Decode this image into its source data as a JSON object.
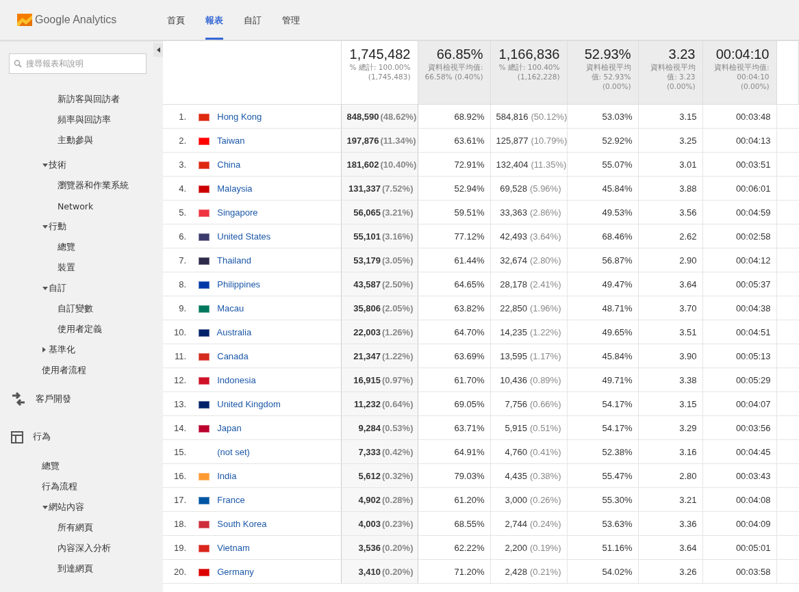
{
  "header": {
    "logo_text": "Google Analytics",
    "tabs": [
      {
        "label": "首頁",
        "selected": false
      },
      {
        "label": "報表",
        "selected": true
      },
      {
        "label": "自訂",
        "selected": false
      },
      {
        "label": "管理",
        "selected": false
      }
    ]
  },
  "sidebar": {
    "search": {
      "placeholder": "搜尋報表和說明"
    },
    "continued_items": [
      {
        "label": "新訪客與回訪者"
      },
      {
        "label": "頻率與回訪率"
      },
      {
        "label": "主動參與"
      }
    ],
    "items": [
      {
        "label": "技術",
        "expanded": true,
        "children": [
          {
            "label": "瀏覽器和作業系統"
          },
          {
            "label": "Network"
          }
        ]
      },
      {
        "label": "行動",
        "expanded": true,
        "children": [
          {
            "label": "總覽"
          },
          {
            "label": "裝置"
          }
        ]
      },
      {
        "label": "自訂",
        "expanded": true,
        "children": [
          {
            "label": "自訂變數"
          },
          {
            "label": "使用者定義"
          }
        ]
      },
      {
        "label": "基準化",
        "expanded": false
      },
      {
        "label": "使用者流程"
      }
    ],
    "sections": [
      {
        "label": "客戶開發",
        "kind": "acquisition"
      },
      {
        "label": "行為",
        "kind": "behavior",
        "children": [
          {
            "label": "總覽"
          },
          {
            "label": "行為流程"
          },
          {
            "label": "網站內容",
            "expanded": true,
            "children": [
              {
                "label": "所有網頁"
              },
              {
                "label": "內容深入分析"
              },
              {
                "label": "到達網頁"
              }
            ]
          }
        ]
      }
    ]
  },
  "table": {
    "columns": [
      {
        "value": "1,745,482",
        "sub_lines": [
          "% 總計: 100.00%",
          "(1,745,483)"
        ],
        "sorted": true
      },
      {
        "value": "66.85%",
        "sub_lines": [
          "資料檢視平均值:",
          "66.58% (0.40%)"
        ],
        "sorted": false
      },
      {
        "value": "1,166,836",
        "sub_lines": [
          "% 總計: 100.40%",
          "(1,162,228)"
        ],
        "sorted": false
      },
      {
        "value": "52.93%",
        "sub_lines": [
          "資料檢視平均",
          "值: 52.93%",
          "(0.00%)"
        ],
        "sorted": false
      },
      {
        "value": "3.23",
        "sub_lines": [
          "資料檢視平均",
          "值: 3.23",
          "(0.00%)"
        ],
        "sorted": false
      },
      {
        "value": "00:04:10",
        "sub_lines": [
          "資料檢視平均值:",
          "00:04:10",
          "(0.00%)"
        ],
        "sorted": false
      }
    ],
    "rows": [
      {
        "rank": "1.",
        "country": "Hong Kong",
        "color": "#de2910",
        "cells": [
          {
            "value": "848,590",
            "share": "(48.62%)"
          },
          {
            "value": "68.92%"
          },
          {
            "value": "584,816",
            "share": "(50.12%)"
          },
          {
            "value": "53.03%"
          },
          {
            "value": "3.15"
          },
          {
            "value": "00:03:48"
          }
        ]
      },
      {
        "rank": "2.",
        "country": "Taiwan",
        "color": "#fe0000",
        "cells": [
          {
            "value": "197,876",
            "share": "(11.34%)"
          },
          {
            "value": "63.61%"
          },
          {
            "value": "125,877",
            "share": "(10.79%)"
          },
          {
            "value": "52.92%"
          },
          {
            "value": "3.25"
          },
          {
            "value": "00:04:13"
          }
        ]
      },
      {
        "rank": "3.",
        "country": "China",
        "color": "#de2910",
        "cells": [
          {
            "value": "181,602",
            "share": "(10.40%)"
          },
          {
            "value": "72.91%"
          },
          {
            "value": "132,404",
            "share": "(11.35%)"
          },
          {
            "value": "55.07%"
          },
          {
            "value": "3.01"
          },
          {
            "value": "00:03:51"
          }
        ]
      },
      {
        "rank": "4.",
        "country": "Malaysia",
        "color": "#cc0001",
        "cells": [
          {
            "value": "131,337",
            "share": "(7.52%)"
          },
          {
            "value": "52.94%"
          },
          {
            "value": "69,528",
            "share": "(5.96%)"
          },
          {
            "value": "45.84%"
          },
          {
            "value": "3.88"
          },
          {
            "value": "00:06:01"
          }
        ]
      },
      {
        "rank": "5.",
        "country": "Singapore",
        "color": "#ef3340",
        "cells": [
          {
            "value": "56,065",
            "share": "(3.21%)"
          },
          {
            "value": "59.51%"
          },
          {
            "value": "33,363",
            "share": "(2.86%)"
          },
          {
            "value": "49.53%"
          },
          {
            "value": "3.56"
          },
          {
            "value": "00:04:59"
          }
        ]
      },
      {
        "rank": "6.",
        "country": "United States",
        "color": "#3c3b6e",
        "cells": [
          {
            "value": "55,101",
            "share": "(3.16%)"
          },
          {
            "value": "77.12%"
          },
          {
            "value": "42,493",
            "share": "(3.64%)"
          },
          {
            "value": "68.46%"
          },
          {
            "value": "2.62"
          },
          {
            "value": "00:02:58"
          }
        ]
      },
      {
        "rank": "7.",
        "country": "Thailand",
        "color": "#2d2a4a",
        "cells": [
          {
            "value": "53,179",
            "share": "(3.05%)"
          },
          {
            "value": "61.44%"
          },
          {
            "value": "32,674",
            "share": "(2.80%)"
          },
          {
            "value": "56.87%"
          },
          {
            "value": "2.90"
          },
          {
            "value": "00:04:12"
          }
        ]
      },
      {
        "rank": "8.",
        "country": "Philippines",
        "color": "#0038a8",
        "cells": [
          {
            "value": "43,587",
            "share": "(2.50%)"
          },
          {
            "value": "64.65%"
          },
          {
            "value": "28,178",
            "share": "(2.41%)"
          },
          {
            "value": "49.47%"
          },
          {
            "value": "3.64"
          },
          {
            "value": "00:05:37"
          }
        ]
      },
      {
        "rank": "9.",
        "country": "Macau",
        "color": "#00785e",
        "cells": [
          {
            "value": "35,806",
            "share": "(2.05%)"
          },
          {
            "value": "63.82%"
          },
          {
            "value": "22,850",
            "share": "(1.96%)"
          },
          {
            "value": "48.71%"
          },
          {
            "value": "3.70"
          },
          {
            "value": "00:04:38"
          }
        ]
      },
      {
        "rank": "10.",
        "country": "Australia",
        "color": "#012169",
        "cells": [
          {
            "value": "22,003",
            "share": "(1.26%)"
          },
          {
            "value": "64.70%"
          },
          {
            "value": "14,235",
            "share": "(1.22%)"
          },
          {
            "value": "49.65%"
          },
          {
            "value": "3.51"
          },
          {
            "value": "00:04:51"
          }
        ]
      },
      {
        "rank": "11.",
        "country": "Canada",
        "color": "#d52b1e",
        "cells": [
          {
            "value": "21,347",
            "share": "(1.22%)"
          },
          {
            "value": "63.69%"
          },
          {
            "value": "13,595",
            "share": "(1.17%)"
          },
          {
            "value": "45.84%"
          },
          {
            "value": "3.90"
          },
          {
            "value": "00:05:13"
          }
        ]
      },
      {
        "rank": "12.",
        "country": "Indonesia",
        "color": "#ce1126",
        "cells": [
          {
            "value": "16,915",
            "share": "(0.97%)"
          },
          {
            "value": "61.70%"
          },
          {
            "value": "10,436",
            "share": "(0.89%)"
          },
          {
            "value": "49.71%"
          },
          {
            "value": "3.38"
          },
          {
            "value": "00:05:29"
          }
        ]
      },
      {
        "rank": "13.",
        "country": "United Kingdom",
        "color": "#012169",
        "cells": [
          {
            "value": "11,232",
            "share": "(0.64%)"
          },
          {
            "value": "69.05%"
          },
          {
            "value": "7,756",
            "share": "(0.66%)"
          },
          {
            "value": "54.17%"
          },
          {
            "value": "3.15"
          },
          {
            "value": "00:04:07"
          }
        ]
      },
      {
        "rank": "14.",
        "country": "Japan",
        "color": "#bc002d",
        "cells": [
          {
            "value": "9,284",
            "share": "(0.53%)"
          },
          {
            "value": "63.71%"
          },
          {
            "value": "5,915",
            "share": "(0.51%)"
          },
          {
            "value": "54.17%"
          },
          {
            "value": "3.29"
          },
          {
            "value": "00:03:56"
          }
        ]
      },
      {
        "rank": "15.",
        "country": "(not set)",
        "cells": [
          {
            "value": "7,333",
            "share": "(0.42%)"
          },
          {
            "value": "64.91%"
          },
          {
            "value": "4,760",
            "share": "(0.41%)"
          },
          {
            "value": "52.38%"
          },
          {
            "value": "3.16"
          },
          {
            "value": "00:04:45"
          }
        ]
      },
      {
        "rank": "16.",
        "country": "India",
        "color": "#ff9933",
        "cells": [
          {
            "value": "5,612",
            "share": "(0.32%)"
          },
          {
            "value": "79.03%"
          },
          {
            "value": "4,435",
            "share": "(0.38%)"
          },
          {
            "value": "55.47%"
          },
          {
            "value": "2.80"
          },
          {
            "value": "00:03:43"
          }
        ]
      },
      {
        "rank": "17.",
        "country": "France",
        "color": "#0055a4",
        "cells": [
          {
            "value": "4,902",
            "share": "(0.28%)"
          },
          {
            "value": "61.20%"
          },
          {
            "value": "3,000",
            "share": "(0.26%)"
          },
          {
            "value": "55.30%"
          },
          {
            "value": "3.21"
          },
          {
            "value": "00:04:08"
          }
        ]
      },
      {
        "rank": "18.",
        "country": "South Korea",
        "color": "#cd2e3a",
        "cells": [
          {
            "value": "4,003",
            "share": "(0.23%)"
          },
          {
            "value": "68.55%"
          },
          {
            "value": "2,744",
            "share": "(0.24%)"
          },
          {
            "value": "53.63%"
          },
          {
            "value": "3.36"
          },
          {
            "value": "00:04:09"
          }
        ]
      },
      {
        "rank": "19.",
        "country": "Vietnam",
        "color": "#da251d",
        "cells": [
          {
            "value": "3,536",
            "share": "(0.20%)"
          },
          {
            "value": "62.22%"
          },
          {
            "value": "2,200",
            "share": "(0.19%)"
          },
          {
            "value": "51.16%"
          },
          {
            "value": "3.64"
          },
          {
            "value": "00:05:01"
          }
        ]
      },
      {
        "rank": "20.",
        "country": "Germany",
        "color": "#dd0000",
        "cells": [
          {
            "value": "3,410",
            "share": "(0.20%)"
          },
          {
            "value": "71.20%"
          },
          {
            "value": "2,428",
            "share": "(0.21%)"
          },
          {
            "value": "54.02%"
          },
          {
            "value": "3.26"
          },
          {
            "value": "00:03:58"
          }
        ]
      }
    ]
  }
}
